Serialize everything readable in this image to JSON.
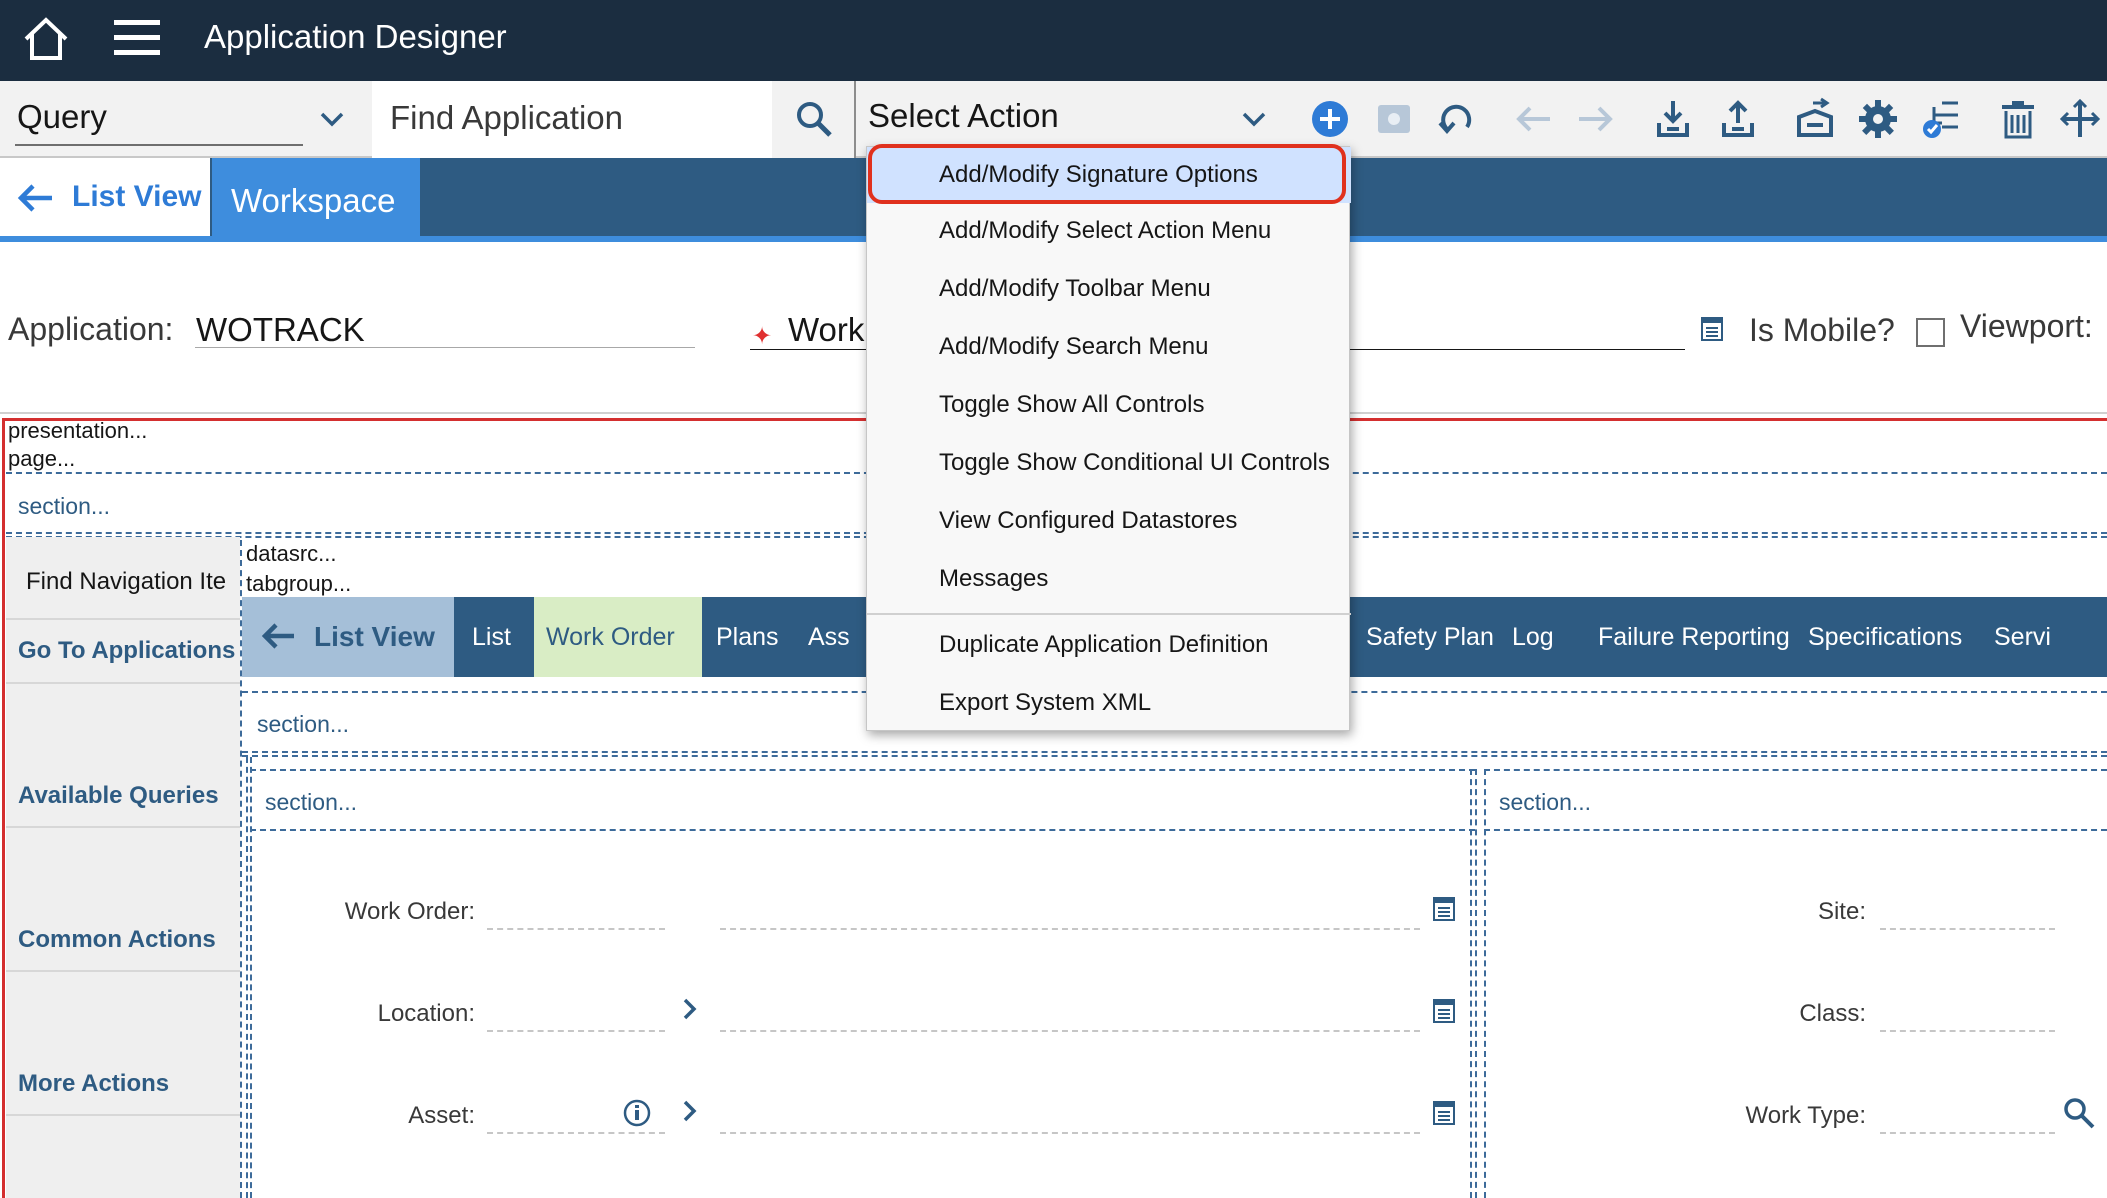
{
  "header": {
    "title": "Application Designer"
  },
  "toolbar": {
    "query_label": "Query",
    "find_placeholder": "Find Application",
    "select_action_label": "Select Action",
    "icons": [
      "add-icon",
      "image-icon",
      "undo-icon",
      "back-arrow-icon",
      "forward-arrow-icon",
      "import-icon",
      "export-icon",
      "import-file-icon",
      "settings-icon",
      "tree-icon",
      "delete-icon",
      "move-icon"
    ]
  },
  "tabs": {
    "list_view": "List View",
    "workspace": "Workspace"
  },
  "fields": {
    "application_label": "Application:",
    "application_value": "WOTRACK",
    "description_label": "Work",
    "mobile_label": "Is Mobile?",
    "viewport_label": "Viewport:"
  },
  "canvas": {
    "presentation": "presentation...",
    "page": "page...",
    "section": "section...",
    "datasrc": "datasrc...",
    "tabgroup": "tabgroup...",
    "find_nav": "Find Navigation Ite",
    "nav": [
      "Go To Applications",
      "Available Queries",
      "Common Actions",
      "More Actions"
    ],
    "inner_tabs": {
      "list_view": "List View",
      "list": "List",
      "work_order": "Work Order",
      "plans": "Plans",
      "ass": "Ass",
      "safety_plan": "Safety Plan",
      "log": "Log",
      "failure_reporting": "Failure Reporting",
      "specifications": "Specifications",
      "serv": "Servi"
    },
    "form_left": [
      "Work Order:",
      "Location:",
      "Asset:"
    ],
    "form_right": [
      "Site:",
      "Class:",
      "Work Type:"
    ]
  },
  "dropdown": {
    "items": [
      "Add/Modify Signature Options",
      "Add/Modify Select Action Menu",
      "Add/Modify Toolbar Menu",
      "Add/Modify Search Menu",
      "Toggle Show All Controls",
      "Toggle Show Conditional UI Controls",
      "View Configured Datastores",
      "Messages",
      "Duplicate Application Definition",
      "Export System XML"
    ]
  },
  "colors": {
    "header_bg": "#1b2d40",
    "tab_bg": "#2e5b82",
    "accent": "#3e8ddd",
    "highlight_ring": "#e0311e"
  }
}
